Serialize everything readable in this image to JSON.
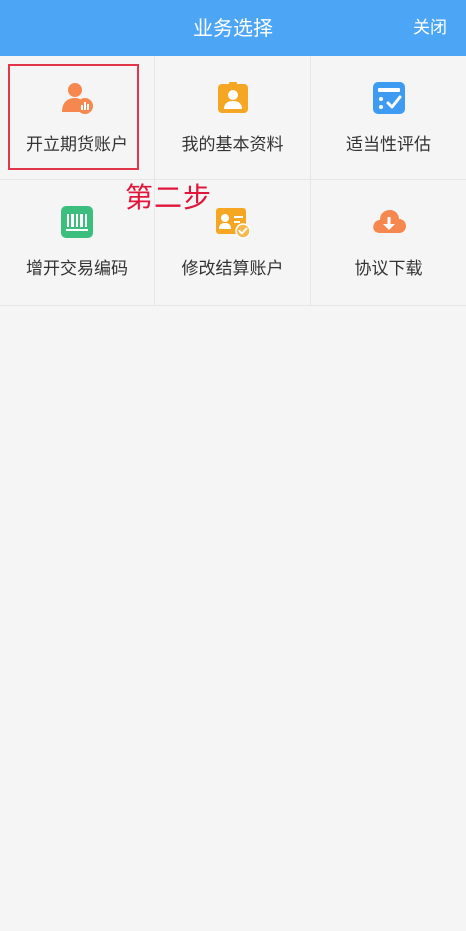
{
  "header": {
    "title": "业务选择",
    "close_label": "关闭"
  },
  "grid": {
    "items": [
      {
        "label": "开立期货账户",
        "icon": "user-chart-icon"
      },
      {
        "label": "我的基本资料",
        "icon": "id-badge-icon"
      },
      {
        "label": "适当性评估",
        "icon": "checklist-icon"
      },
      {
        "label": "增开交易编码",
        "icon": "barcode-icon"
      },
      {
        "label": "修改结算账户",
        "icon": "card-check-icon"
      },
      {
        "label": "协议下载",
        "icon": "cloud-download-icon"
      }
    ]
  },
  "annotation": {
    "step_text": "第二步",
    "highlight_color": "#e2374b"
  },
  "colors": {
    "header": "#4da6f5",
    "orange": "#f5874f",
    "amber": "#f5a623",
    "blue": "#3d9bf2",
    "green": "#3cbf7e"
  }
}
